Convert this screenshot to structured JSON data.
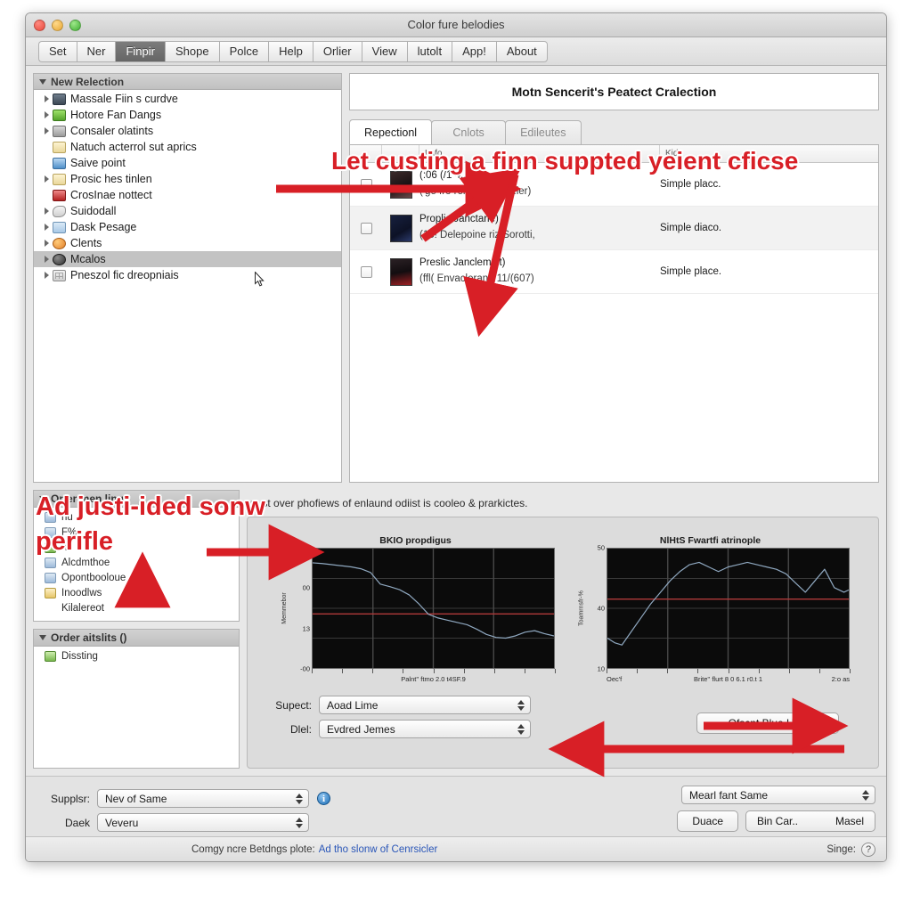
{
  "window": {
    "title": "Color fure belodies",
    "traffic_lights": [
      "close",
      "minimize",
      "maximize"
    ]
  },
  "toolbar": {
    "buttons": [
      {
        "label": "Set",
        "active": false
      },
      {
        "label": "Ner",
        "active": false
      },
      {
        "label": "Finpir",
        "active": true
      },
      {
        "label": "Shope",
        "active": false
      },
      {
        "label": "Polce",
        "active": false
      },
      {
        "label": "Help",
        "active": false
      },
      {
        "label": "Orlier",
        "active": false
      },
      {
        "label": "View",
        "active": false
      },
      {
        "label": "lutolt",
        "active": false
      },
      {
        "label": "App!",
        "active": false
      },
      {
        "label": "About",
        "active": false
      }
    ]
  },
  "sidebar": {
    "header": "New Relection",
    "items": [
      {
        "label": "Massale Fiin s curdve",
        "icon": "app-icon",
        "disclosure": true,
        "selected": false
      },
      {
        "label": "Hotore Fan Dangs",
        "icon": "puzzle-icon",
        "disclosure": true,
        "selected": false
      },
      {
        "label": "Consaler olatints",
        "icon": "cart-icon",
        "disclosure": true,
        "selected": false
      },
      {
        "label": "Natuch acterrol sut aprics",
        "icon": "folder-icon",
        "disclosure": false,
        "selected": false
      },
      {
        "label": "Saive point",
        "icon": "window-icon",
        "disclosure": false,
        "selected": false
      },
      {
        "label": "Prosic hes tinlen",
        "icon": "folder-icon",
        "disclosure": true,
        "selected": false
      },
      {
        "label": "CrosInae nottect",
        "icon": "alert-icon",
        "disclosure": false,
        "selected": false
      },
      {
        "label": "Suidodall",
        "icon": "pen-icon",
        "disclosure": true,
        "selected": false
      },
      {
        "label": "Dask Pesage",
        "icon": "desktop-icon",
        "disclosure": true,
        "selected": false
      },
      {
        "label": "Clents",
        "icon": "clock-icon",
        "disclosure": true,
        "selected": false
      },
      {
        "label": "Mcalos",
        "icon": "disc-icon",
        "disclosure": true,
        "selected": true
      },
      {
        "label": "Pneszol fic dreopniais",
        "icon": "grid-icon",
        "disclosure": true,
        "selected": false
      }
    ]
  },
  "detail": {
    "title": "Motn Sencerit's Peatect Cralection",
    "tabs": [
      {
        "label": "Repectionl",
        "selected": true
      },
      {
        "label": "Cnlots",
        "selected": false
      },
      {
        "label": "Edileutes",
        "selected": false
      }
    ],
    "table": {
      "columns": [
        "",
        "",
        "Lnfo",
        "Kid"
      ],
      "rows": [
        {
          "checked": false,
          "thumb": "album-thumb-1",
          "name": "(:06 (/1 4...)",
          "sub": "('ge fro remacY. ... t4.ler)",
          "kind": "Simple placc."
        },
        {
          "checked": false,
          "thumb": "album-thumb-2",
          "name": "Proplic Janctarle)",
          "sub": "(15! Delepoine riz Sorotti,",
          "kind": "Simple diaco."
        },
        {
          "checked": false,
          "thumb": "album-thumb-3",
          "name": "Preslic Janclemelt)",
          "sub": "(ffl( Envaclerant: 11/(607)",
          "kind": "Simple place."
        }
      ]
    }
  },
  "left_panels": [
    {
      "header": "Orfer men ling",
      "items": [
        {
          "label": "nu",
          "icon": "blue-icon"
        },
        {
          "label": "F%",
          "icon": "blue-icon"
        },
        {
          "label": "nv",
          "icon": "green-icon"
        },
        {
          "label": "Alcdmthoe",
          "icon": "blue-icon"
        },
        {
          "label": "Opontbooloue",
          "icon": "blue-icon"
        },
        {
          "label": "Inoodlws",
          "icon": "yellow-icon"
        },
        {
          "label": "Kilalereot",
          "icon": "none"
        }
      ]
    },
    {
      "header": "Order aitslits ()",
      "items": [
        {
          "label": "Dissting",
          "icon": "green-icon"
        }
      ]
    }
  ],
  "description": "nust over phofiews of enlaund odiist is cooleo & prarkictes.",
  "chart_data": [
    {
      "type": "line",
      "title": "BKIO propdigus",
      "ylabel": "Memmebor",
      "xlabel": "Palnt'' ftmo 2.0 t4SF.9",
      "yticks": [
        "2.60",
        "00",
        "13",
        "-00"
      ],
      "ylim": [
        -60,
        260
      ],
      "grid": true,
      "reference_line": 85,
      "reference_color": "#b03a3a",
      "line_color": "#8fa8c0",
      "background": "#0b0b0b",
      "x": [
        0,
        4,
        8,
        12,
        16,
        20,
        24,
        28,
        32,
        36,
        40,
        44,
        48,
        52,
        56,
        60,
        64,
        68,
        72,
        76,
        80,
        84,
        88,
        92,
        96,
        100
      ],
      "values": [
        222,
        220,
        217,
        214,
        211,
        206,
        196,
        165,
        158,
        150,
        136,
        112,
        84,
        74,
        68,
        62,
        56,
        44,
        30,
        22,
        20,
        26,
        36,
        40,
        32,
        26
      ]
    },
    {
      "type": "line",
      "title": "NlHtS Fwartfi atrinople",
      "ylabel": "Toamrnsfr-%",
      "xlabel": "Brite'' flurt 8 0 6.1 r0.t 1",
      "xlabel_left": "Oec'f",
      "xlabel_right": "2:o as",
      "yticks": [
        "50",
        "40",
        "10"
      ],
      "ylim": [
        0,
        52
      ],
      "grid": true,
      "reference_line": 30,
      "reference_color": "#b03a3a",
      "line_color": "#8fa8c0",
      "background": "#0b0b0b",
      "x": [
        0,
        3,
        6,
        10,
        14,
        18,
        22,
        26,
        30,
        34,
        38,
        42,
        46,
        50,
        54,
        58,
        62,
        66,
        70,
        74,
        78,
        82,
        86,
        90,
        94,
        98,
        100
      ],
      "values": [
        13,
        11,
        10,
        16,
        22,
        28,
        33,
        38,
        42,
        45,
        46,
        44,
        42,
        44,
        45,
        46,
        45,
        44,
        43,
        41,
        37,
        33,
        38,
        43,
        35,
        33,
        34
      ]
    }
  ],
  "form": {
    "rows": [
      {
        "label": "Supect:",
        "value": "Aoad Lime"
      },
      {
        "label": "Dlel:",
        "value": "Evdred Jemes"
      }
    ],
    "overlay_button": "Ofscnt Blue Hiwt"
  },
  "bottom": {
    "rows": [
      {
        "label": "Supplsr:",
        "value": "Nev of Same",
        "info": true
      },
      {
        "label": "Daek",
        "value": "Veveru",
        "info": false
      }
    ],
    "right_combo": "Mearl fant Same",
    "buttons": [
      "Duace",
      "Bin Car..",
      "Masel"
    ]
  },
  "status": {
    "text": "Comgy ncre Betdngs plote:",
    "link": "Ad tho slonw of Cenrsicler",
    "right_label": "Singe:",
    "help_glyph": "?"
  },
  "annotations": [
    {
      "id": "ann1",
      "text": "Let custing a finn suppted yeient cficse"
    },
    {
      "id": "ann2",
      "text": "Ad justi-ided sonw"
    },
    {
      "id": "ann3",
      "text": "perifle"
    }
  ],
  "colors": {
    "annotation_red": "#d81f26",
    "link_blue": "#2a56b8",
    "selection_gray": "#c3c3c3",
    "chart_line": "#8fa8c0",
    "chart_ref": "#b03a3a"
  }
}
